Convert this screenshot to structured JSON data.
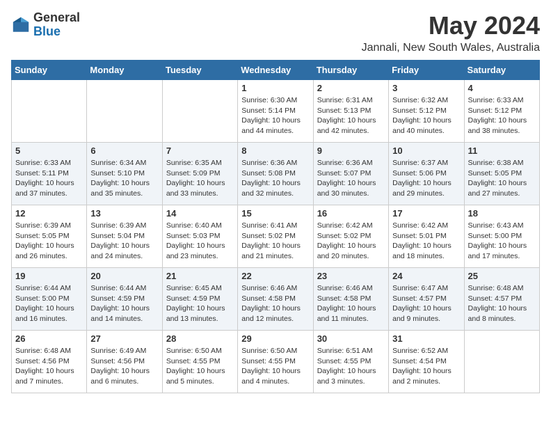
{
  "header": {
    "logo_line1": "General",
    "logo_line2": "Blue",
    "title": "May 2024",
    "subtitle": "Jannali, New South Wales, Australia"
  },
  "days_of_week": [
    "Sunday",
    "Monday",
    "Tuesday",
    "Wednesday",
    "Thursday",
    "Friday",
    "Saturday"
  ],
  "weeks": [
    [
      {
        "day": "",
        "info": ""
      },
      {
        "day": "",
        "info": ""
      },
      {
        "day": "",
        "info": ""
      },
      {
        "day": "1",
        "info": "Sunrise: 6:30 AM\nSunset: 5:14 PM\nDaylight: 10 hours\nand 44 minutes."
      },
      {
        "day": "2",
        "info": "Sunrise: 6:31 AM\nSunset: 5:13 PM\nDaylight: 10 hours\nand 42 minutes."
      },
      {
        "day": "3",
        "info": "Sunrise: 6:32 AM\nSunset: 5:12 PM\nDaylight: 10 hours\nand 40 minutes."
      },
      {
        "day": "4",
        "info": "Sunrise: 6:33 AM\nSunset: 5:12 PM\nDaylight: 10 hours\nand 38 minutes."
      }
    ],
    [
      {
        "day": "5",
        "info": "Sunrise: 6:33 AM\nSunset: 5:11 PM\nDaylight: 10 hours\nand 37 minutes."
      },
      {
        "day": "6",
        "info": "Sunrise: 6:34 AM\nSunset: 5:10 PM\nDaylight: 10 hours\nand 35 minutes."
      },
      {
        "day": "7",
        "info": "Sunrise: 6:35 AM\nSunset: 5:09 PM\nDaylight: 10 hours\nand 33 minutes."
      },
      {
        "day": "8",
        "info": "Sunrise: 6:36 AM\nSunset: 5:08 PM\nDaylight: 10 hours\nand 32 minutes."
      },
      {
        "day": "9",
        "info": "Sunrise: 6:36 AM\nSunset: 5:07 PM\nDaylight: 10 hours\nand 30 minutes."
      },
      {
        "day": "10",
        "info": "Sunrise: 6:37 AM\nSunset: 5:06 PM\nDaylight: 10 hours\nand 29 minutes."
      },
      {
        "day": "11",
        "info": "Sunrise: 6:38 AM\nSunset: 5:05 PM\nDaylight: 10 hours\nand 27 minutes."
      }
    ],
    [
      {
        "day": "12",
        "info": "Sunrise: 6:39 AM\nSunset: 5:05 PM\nDaylight: 10 hours\nand 26 minutes."
      },
      {
        "day": "13",
        "info": "Sunrise: 6:39 AM\nSunset: 5:04 PM\nDaylight: 10 hours\nand 24 minutes."
      },
      {
        "day": "14",
        "info": "Sunrise: 6:40 AM\nSunset: 5:03 PM\nDaylight: 10 hours\nand 23 minutes."
      },
      {
        "day": "15",
        "info": "Sunrise: 6:41 AM\nSunset: 5:02 PM\nDaylight: 10 hours\nand 21 minutes."
      },
      {
        "day": "16",
        "info": "Sunrise: 6:42 AM\nSunset: 5:02 PM\nDaylight: 10 hours\nand 20 minutes."
      },
      {
        "day": "17",
        "info": "Sunrise: 6:42 AM\nSunset: 5:01 PM\nDaylight: 10 hours\nand 18 minutes."
      },
      {
        "day": "18",
        "info": "Sunrise: 6:43 AM\nSunset: 5:00 PM\nDaylight: 10 hours\nand 17 minutes."
      }
    ],
    [
      {
        "day": "19",
        "info": "Sunrise: 6:44 AM\nSunset: 5:00 PM\nDaylight: 10 hours\nand 16 minutes."
      },
      {
        "day": "20",
        "info": "Sunrise: 6:44 AM\nSunset: 4:59 PM\nDaylight: 10 hours\nand 14 minutes."
      },
      {
        "day": "21",
        "info": "Sunrise: 6:45 AM\nSunset: 4:59 PM\nDaylight: 10 hours\nand 13 minutes."
      },
      {
        "day": "22",
        "info": "Sunrise: 6:46 AM\nSunset: 4:58 PM\nDaylight: 10 hours\nand 12 minutes."
      },
      {
        "day": "23",
        "info": "Sunrise: 6:46 AM\nSunset: 4:58 PM\nDaylight: 10 hours\nand 11 minutes."
      },
      {
        "day": "24",
        "info": "Sunrise: 6:47 AM\nSunset: 4:57 PM\nDaylight: 10 hours\nand 9 minutes."
      },
      {
        "day": "25",
        "info": "Sunrise: 6:48 AM\nSunset: 4:57 PM\nDaylight: 10 hours\nand 8 minutes."
      }
    ],
    [
      {
        "day": "26",
        "info": "Sunrise: 6:48 AM\nSunset: 4:56 PM\nDaylight: 10 hours\nand 7 minutes."
      },
      {
        "day": "27",
        "info": "Sunrise: 6:49 AM\nSunset: 4:56 PM\nDaylight: 10 hours\nand 6 minutes."
      },
      {
        "day": "28",
        "info": "Sunrise: 6:50 AM\nSunset: 4:55 PM\nDaylight: 10 hours\nand 5 minutes."
      },
      {
        "day": "29",
        "info": "Sunrise: 6:50 AM\nSunset: 4:55 PM\nDaylight: 10 hours\nand 4 minutes."
      },
      {
        "day": "30",
        "info": "Sunrise: 6:51 AM\nSunset: 4:55 PM\nDaylight: 10 hours\nand 3 minutes."
      },
      {
        "day": "31",
        "info": "Sunrise: 6:52 AM\nSunset: 4:54 PM\nDaylight: 10 hours\nand 2 minutes."
      },
      {
        "day": "",
        "info": ""
      }
    ]
  ]
}
